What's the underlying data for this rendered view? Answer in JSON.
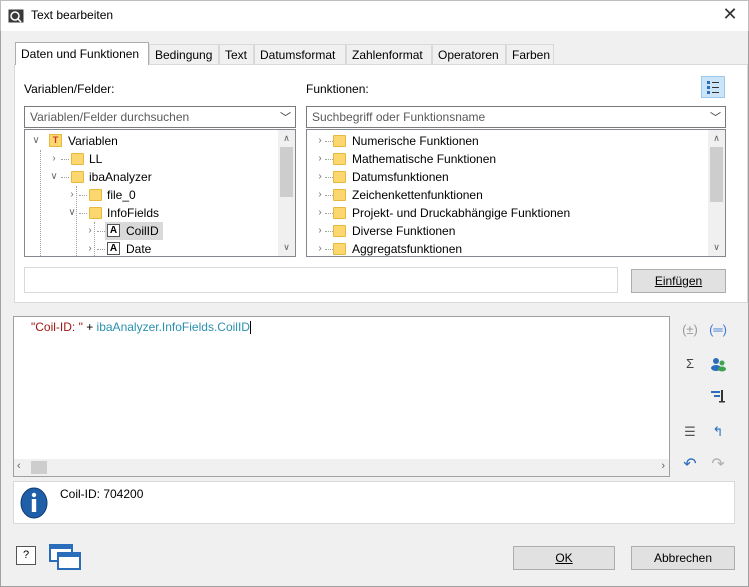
{
  "window": {
    "title": "Text bearbeiten",
    "close_glyph": "✕"
  },
  "tabs": [
    {
      "label": "Daten und Funktionen",
      "active": true
    },
    {
      "label": "Bedingung",
      "active": false
    },
    {
      "label": "Text",
      "active": false
    },
    {
      "label": "Datumsformat",
      "active": false
    },
    {
      "label": "Zahlenformat",
      "active": false
    },
    {
      "label": "Operatoren",
      "active": false
    },
    {
      "label": "Farben",
      "active": false
    }
  ],
  "variables": {
    "label": "Variablen/Felder:",
    "search_placeholder": "Variablen/Felder durchsuchen",
    "tree": [
      {
        "label": "Variablen",
        "icon": "variables-icon"
      },
      {
        "label": "LL",
        "icon": "folder-icon"
      },
      {
        "label": "ibaAnalyzer",
        "icon": "folder-icon"
      },
      {
        "label": "file_0",
        "icon": "folder-icon"
      },
      {
        "label": "InfoFields",
        "icon": "folder-icon"
      },
      {
        "label": "CoilID",
        "icon": "text-field-icon",
        "selected": true
      },
      {
        "label": "Date",
        "icon": "text-field-icon"
      }
    ]
  },
  "functions": {
    "label": "Funktionen:",
    "search_placeholder": "Suchbegriff oder Funktionsname",
    "tree": [
      {
        "label": "Numerische Funktionen"
      },
      {
        "label": "Mathematische Funktionen"
      },
      {
        "label": "Datumsfunktionen"
      },
      {
        "label": "Zeichenkettenfunktionen"
      },
      {
        "label": "Projekt- und Druckabhängige Funktionen"
      },
      {
        "label": "Diverse Funktionen"
      },
      {
        "label": "Aggregatsfunktionen"
      }
    ]
  },
  "insert_button": "Einfügen",
  "editor": {
    "string_literal": "\"Coil-ID: \"",
    "operator": " + ",
    "field": "ibaAnalyzer.InfoFields.CoilID",
    "colors": {
      "string": "#a31515",
      "field": "#2b91af"
    }
  },
  "result": {
    "text": "Coil-ID: 704200"
  },
  "footer": {
    "ok_label": "OK",
    "cancel_label": "Abbrechen"
  }
}
